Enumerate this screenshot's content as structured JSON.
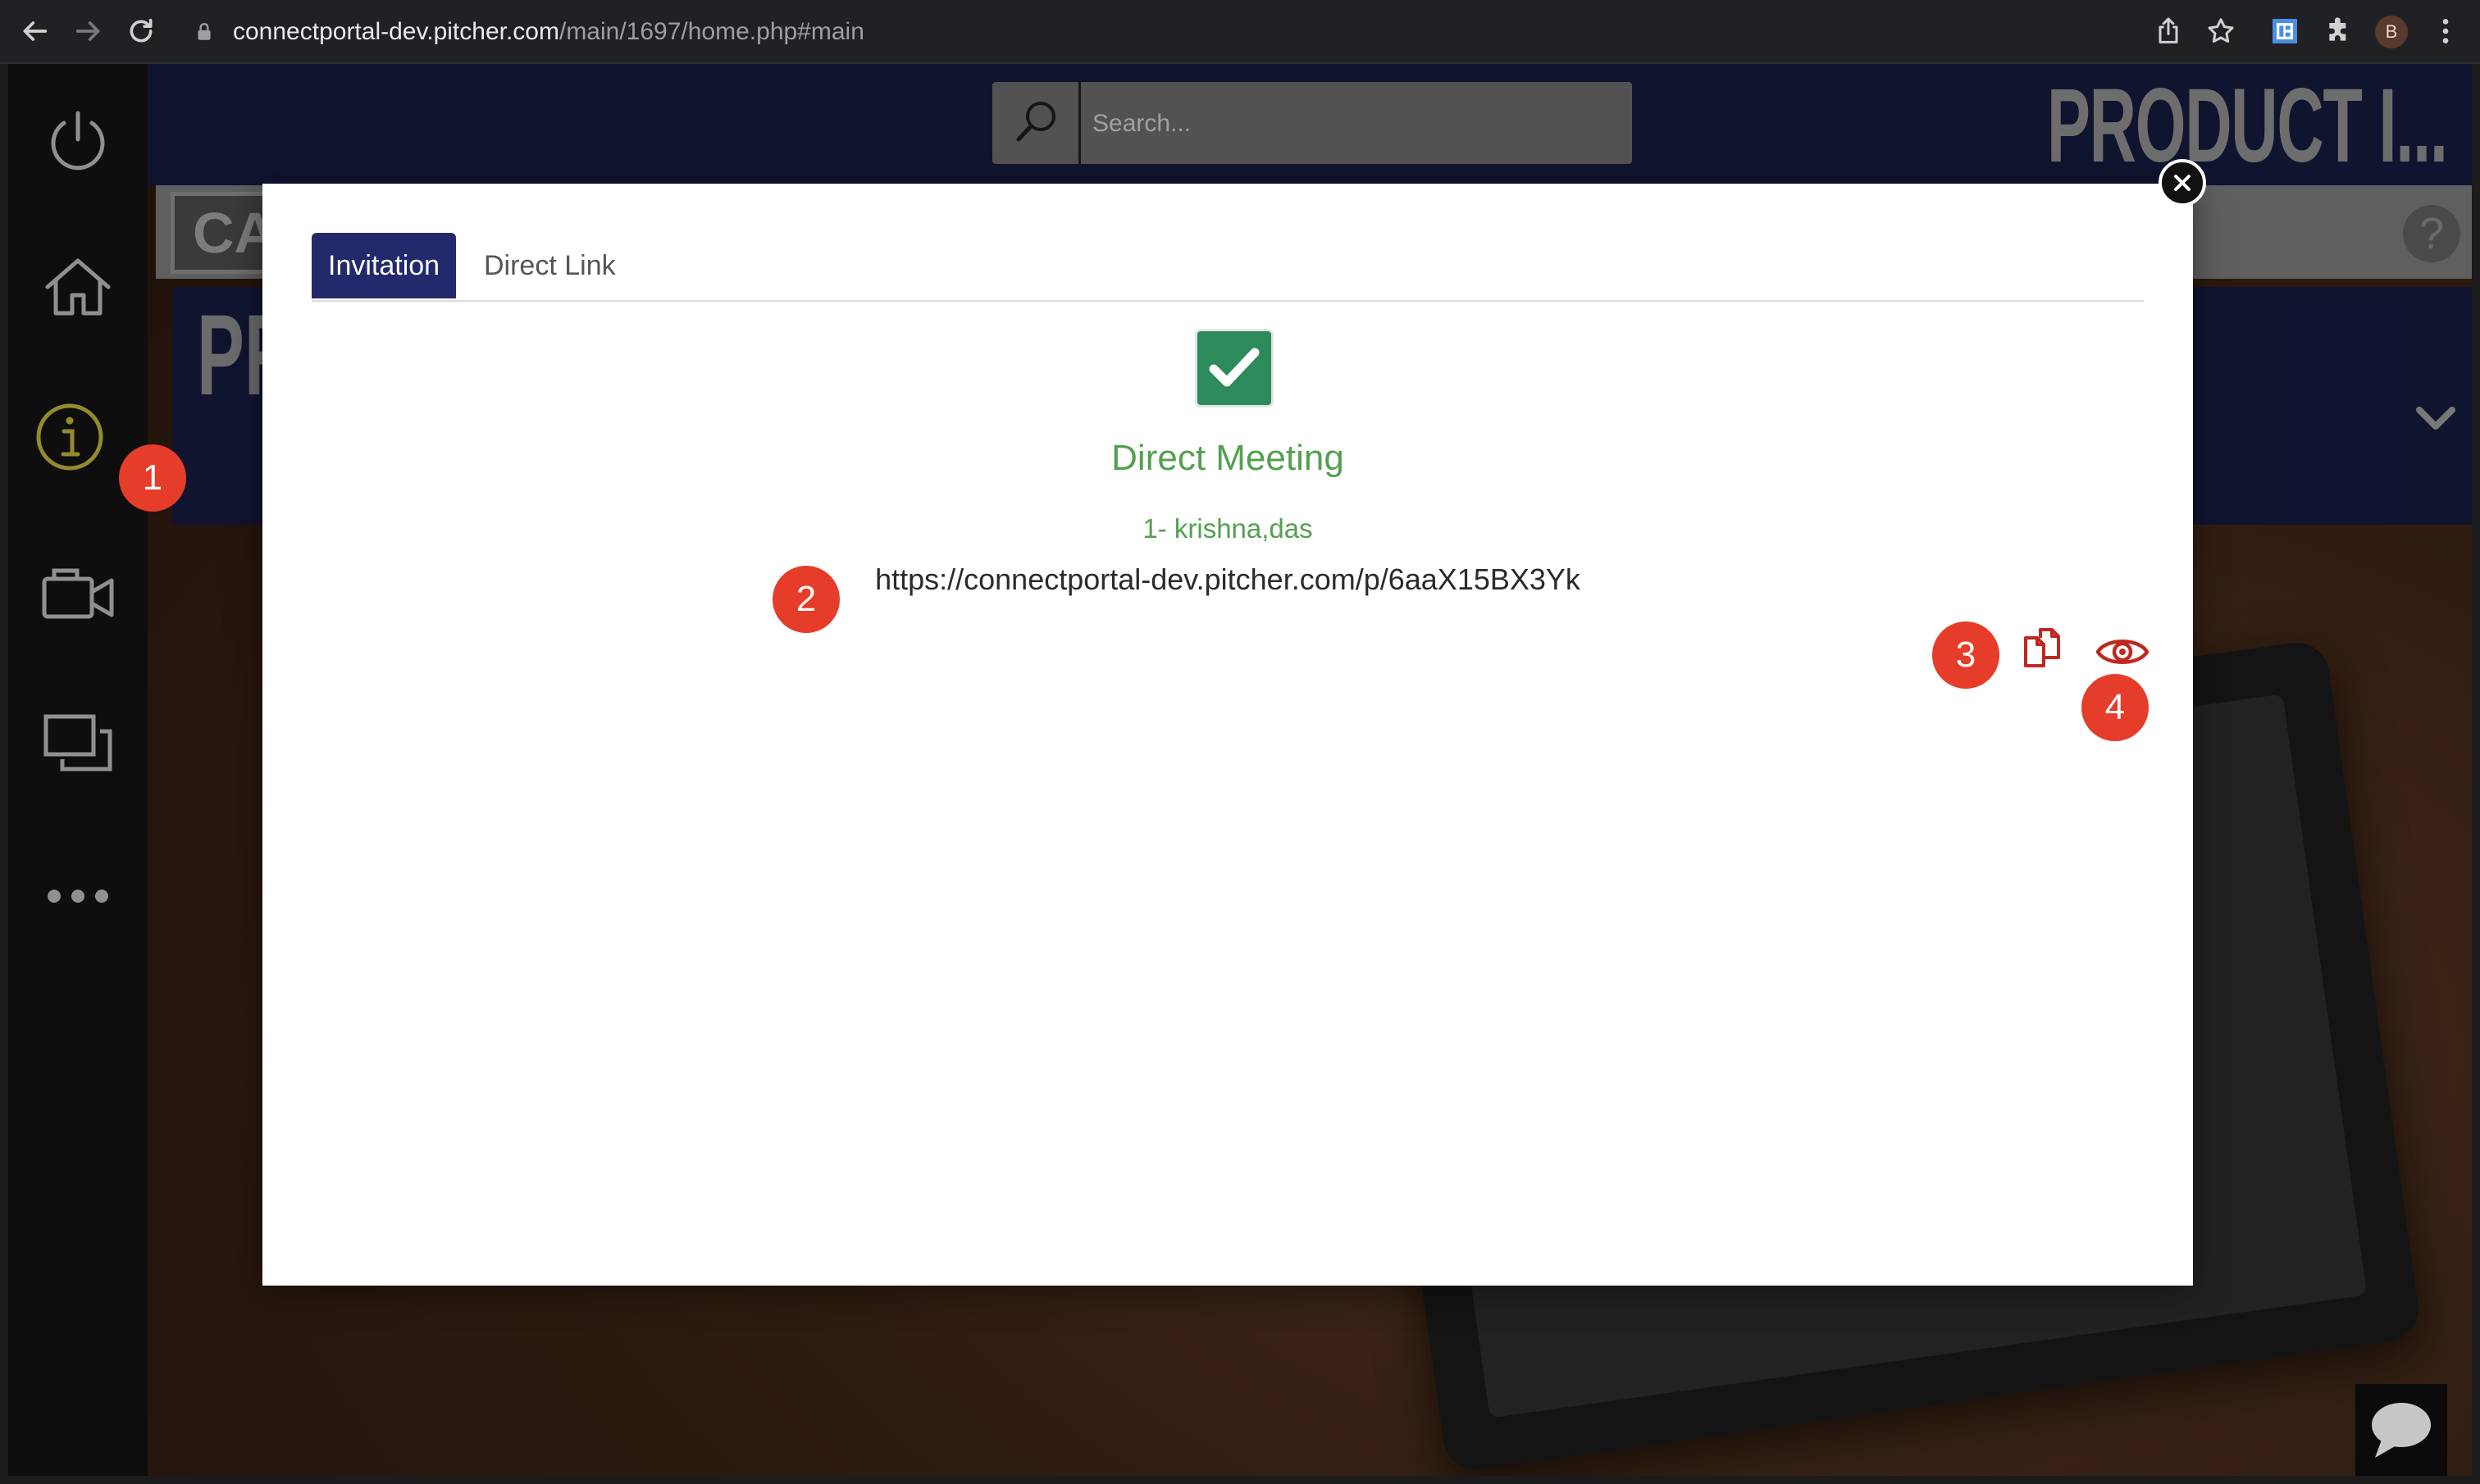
{
  "browser": {
    "url_host": "connectportal-dev.pitcher.com",
    "url_path": "/main/1697/home.php#main",
    "profile_initial": "B"
  },
  "app": {
    "search": {
      "placeholder": "Search..."
    },
    "header_title": "PRODUCT I...",
    "category_label": "CATE",
    "help_label": "?",
    "section_title": "PR"
  },
  "modal": {
    "tabs": [
      {
        "label": "Invitation",
        "active": true
      },
      {
        "label": "Direct Link",
        "active": false
      }
    ],
    "title": "Direct Meeting",
    "participant": "1- krishna,das",
    "link": "https://connectportal-dev.pitcher.com/p/6aaX15BX3Yk"
  },
  "markers": [
    "1",
    "2",
    "3",
    "4"
  ],
  "colors": {
    "accent_navy": "#232a6b",
    "success_green": "#53a04e",
    "marker_red": "#e63c2a",
    "action_red": "#c0281f"
  },
  "icons": {
    "sidebar": [
      "power-icon",
      "home-icon",
      "info-icon",
      "video-camera-icon",
      "presentations-icon",
      "more-icon"
    ],
    "actions": [
      "copy-icon",
      "eye-icon"
    ]
  }
}
